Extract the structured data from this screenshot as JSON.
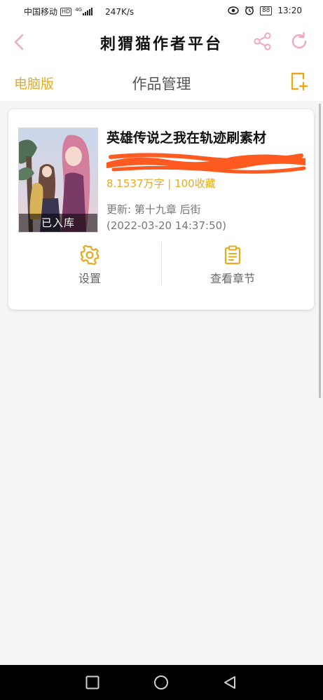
{
  "status_bar": {
    "carrier": "中国移动",
    "hd_badge": "HD",
    "network_type": "4G",
    "speed": "247K/s",
    "battery": "88",
    "time": "13:20"
  },
  "header": {
    "app_title": "刺猬猫作者平台"
  },
  "subheader": {
    "pc_version_label": "电脑版",
    "page_title": "作品管理"
  },
  "book": {
    "cover_badge": "已入库",
    "title": "英雄传说之我在轨迹刷素材",
    "stats": "8.1537万字 | 100收藏",
    "update_line": "更新:  第十九章 后街",
    "update_time": "(2022-03-20 14:37:50)"
  },
  "actions": {
    "settings_label": "设置",
    "chapters_label": "查看章节"
  },
  "colors": {
    "accent": "#e8a91d",
    "header_icon": "#f2a7bd",
    "redaction": "#ff5a1f"
  }
}
